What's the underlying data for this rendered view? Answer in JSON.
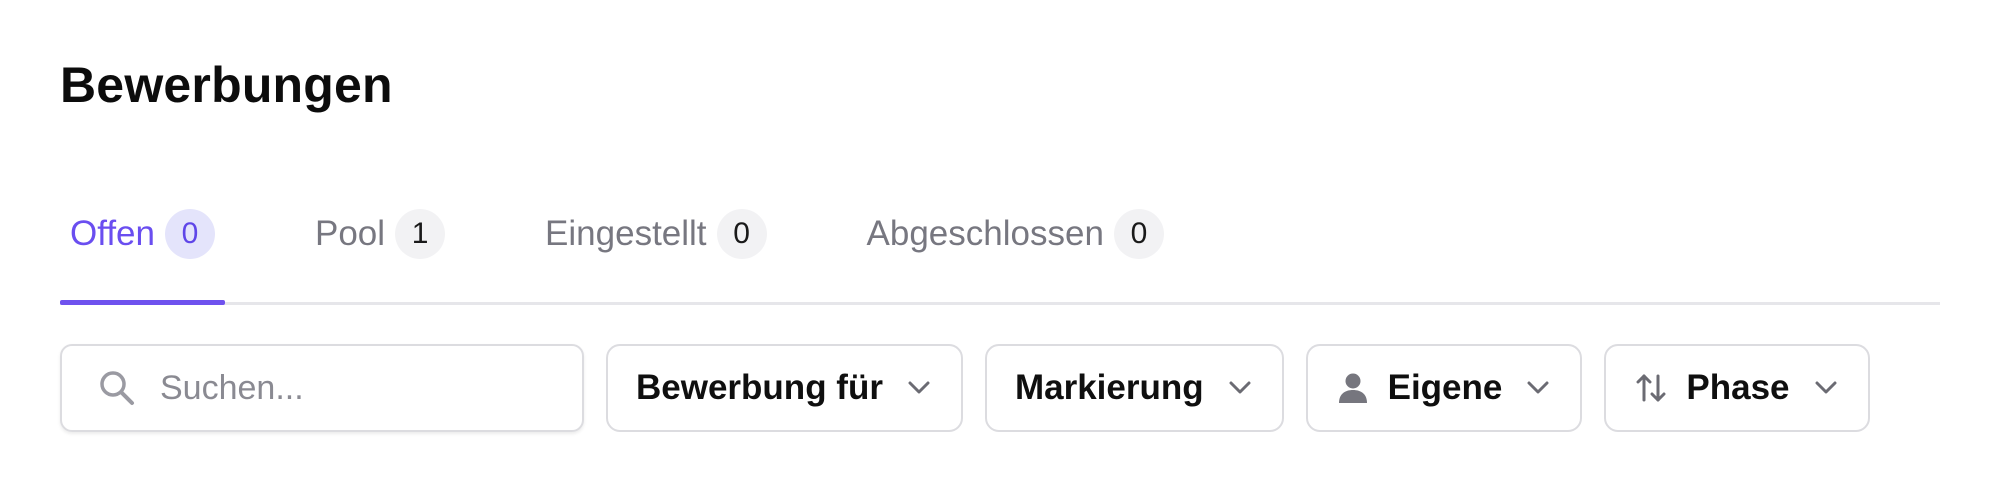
{
  "header": {
    "title": "Bewerbungen"
  },
  "tabs": [
    {
      "label": "Offen",
      "count": "0",
      "active": true
    },
    {
      "label": "Pool",
      "count": "1",
      "active": false
    },
    {
      "label": "Eingestellt",
      "count": "0",
      "active": false
    },
    {
      "label": "Abgeschlossen",
      "count": "0",
      "active": false
    }
  ],
  "filters": {
    "search": {
      "placeholder": "Suchen...",
      "value": "",
      "icon": "search-icon"
    },
    "application_for": {
      "label": "Bewerbung für",
      "icon": "chevron-down-icon"
    },
    "marking": {
      "label": "Markierung",
      "icon": "chevron-down-icon"
    },
    "owner": {
      "label": "Eigene",
      "lead_icon": "person-icon",
      "icon": "chevron-down-icon"
    },
    "phase": {
      "label": "Phase",
      "lead_icon": "sort-arrows-icon",
      "icon": "chevron-down-icon"
    }
  },
  "colors": {
    "accent": "#6f52ee",
    "accent_badge_bg": "#e4e4fb",
    "tab_inactive": "#777780",
    "border": "#dcdce0"
  }
}
